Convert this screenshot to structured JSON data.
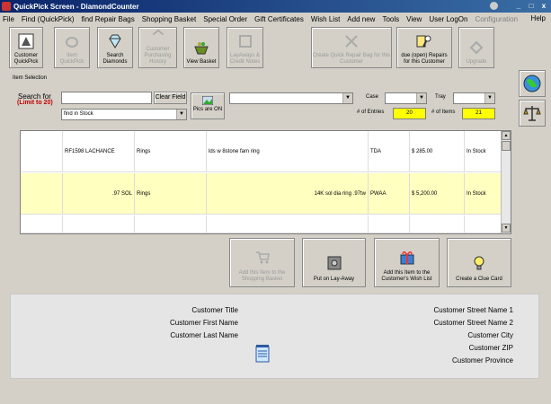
{
  "window": {
    "title": "QuickPick Screen - DiamondCounter"
  },
  "titlebar_buttons": [
    "_",
    "□",
    "x"
  ],
  "menu": {
    "items": [
      "File",
      "Find (QuickPick)",
      "find Repair Bags",
      "Shopping Basket",
      "Special Order",
      "Gift Certificates",
      "Wish List",
      "Add new",
      "Tools",
      "View",
      "User LogOn",
      "Configuration"
    ],
    "disabled": [
      false,
      false,
      false,
      false,
      false,
      false,
      false,
      false,
      false,
      false,
      false,
      true
    ],
    "help": "Help"
  },
  "toolbar": [
    {
      "label": "Customer QuickPick",
      "disabled": false,
      "icon": "customer-icon"
    },
    {
      "label": "Item QuickPick",
      "disabled": true,
      "icon": "ring-icon"
    },
    {
      "label": "Search Diamonds",
      "disabled": false,
      "icon": "diamond-icon"
    },
    {
      "label": "Customer Purchasing History",
      "disabled": true,
      "icon": "history-icon"
    },
    {
      "label": "View Basket",
      "disabled": false,
      "icon": "basket-icon"
    },
    {
      "label": "LayAways & Credit Notes",
      "disabled": true,
      "icon": "layaway-icon"
    },
    {
      "label": "Create Quick Repair Bag for this Customer",
      "disabled": true,
      "icon": "tools-icon"
    },
    {
      "label": "due (open) Repairs for this Customer",
      "disabled": false,
      "icon": "repair-icon"
    },
    {
      "label": "Upgrade",
      "disabled": true,
      "icon": "upgrade-icon"
    }
  ],
  "item_selection": {
    "group_label": "Item Selection",
    "search_label": "Search for",
    "limit_label": "(Limit to 20)",
    "search_value": "",
    "clear_button": "Clear Field",
    "filter_select": "find in Stock",
    "pics_button": "Pics are ON",
    "category_select": "",
    "case_label": "Case",
    "case_select": "",
    "tray_label": "Tray",
    "tray_select": "",
    "entries_label": "# of Entries",
    "entries_value": "20",
    "items_label": "# of Items",
    "items_value": "21"
  },
  "grid": {
    "rows": [
      {
        "sku": "RF1598 LACHANCE",
        "category": "Rings",
        "description": "lds w 8stone fam ring",
        "vendor": "TDA",
        "price": "$ 285.00",
        "status": "In Stock",
        "selected": false
      },
      {
        "sku": ".97 SOL",
        "category": "Rings",
        "description": "14K sol dia ring .97tw",
        "vendor": "PWAA",
        "price": "$ 5,200.00",
        "status": "In Stock",
        "selected": true
      }
    ]
  },
  "actions": [
    {
      "label": "Add this Item to the Shopping Basket",
      "disabled": true,
      "icon": "cart-icon"
    },
    {
      "label": "Put on Lay-Away",
      "disabled": false,
      "icon": "safe-icon"
    },
    {
      "label": "Add this Item to the Customer's Wish List",
      "disabled": false,
      "icon": "gift-icon"
    },
    {
      "label": "Create a Clue Card",
      "disabled": false,
      "icon": "lightbulb-icon"
    }
  ],
  "customer": {
    "left": [
      "Customer Title",
      "Customer First Name",
      "Customer Last Name"
    ],
    "right": [
      "Customer Street Name 1",
      "Customer Street Name 2",
      "Customer City",
      "Customer ZIP",
      "Customer Province"
    ]
  },
  "colors": {
    "titlebar": "#0a246a",
    "limit_red": "#c00000",
    "highlight_yellow": "#ffff00",
    "selected_row": "#ffffc0"
  }
}
